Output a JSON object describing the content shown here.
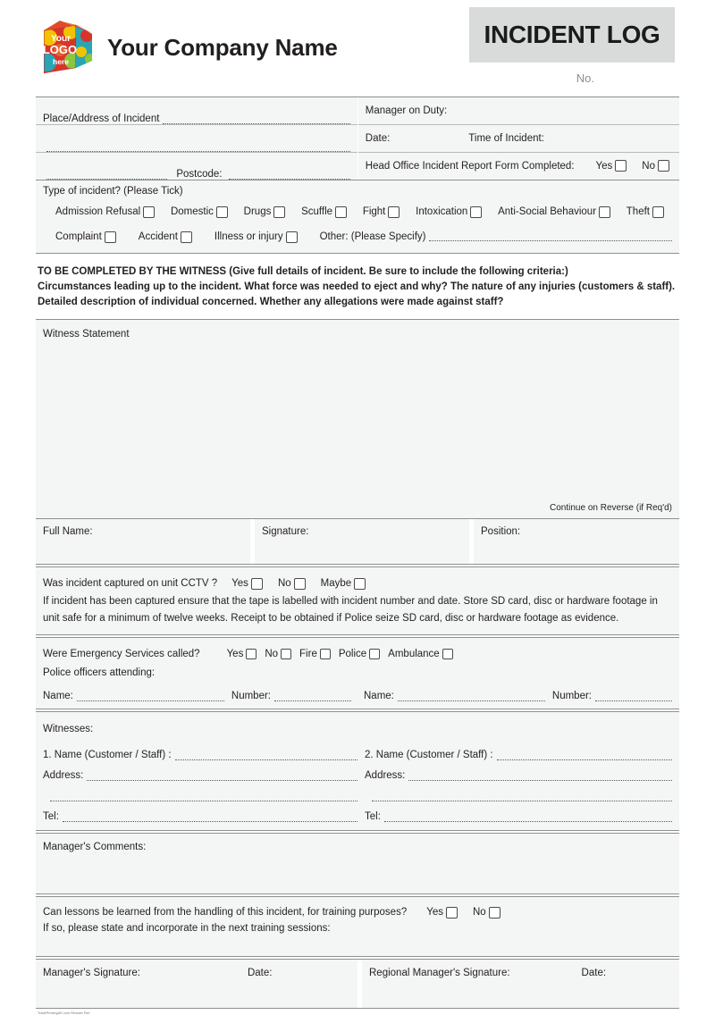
{
  "header": {
    "logo_alt": "Your LOGO here",
    "logo_line1": "Your",
    "logo_line2": "LOGO",
    "logo_line3": "here",
    "company_name": "Your Company Name",
    "form_title": "INCIDENT LOG",
    "number_label": "No."
  },
  "incident_place": {
    "place_label": "Place/Address of Incident",
    "postcode_label": "Postcode:",
    "manager_on_duty_label": "Manager on Duty:",
    "date_label": "Date:",
    "time_label": "Time of Incident:",
    "head_office_label": "Head Office Incident Report Form Completed:",
    "yes_label": "Yes",
    "no_label": "No"
  },
  "incident_type": {
    "title": "Type of incident? (Please Tick)",
    "row1": [
      "Admission Refusal",
      "Domestic",
      "Drugs",
      "Scuffle",
      "Fight",
      "Intoxication",
      "Anti-Social Behaviour",
      "Theft"
    ],
    "row2": [
      "Complaint",
      "Accident",
      "Illness or injury"
    ],
    "other_label": "Other: (Please Specify)"
  },
  "instructions": {
    "line1": "TO BE COMPLETED BY THE WITNESS (Give full details of incident. Be sure to include the following criteria:)",
    "line2": "Circumstances leading up to the incident. What force was needed to eject and why? The nature of any injuries (customers & staff).",
    "line3": "Detailed description of individual concerned. Whether any allegations were made against staff?"
  },
  "witness_statement": {
    "title": "Witness Statement",
    "continue_note": "Continue on Reverse (if Req'd)"
  },
  "witness_identity": {
    "full_name_label": "Full Name:",
    "signature_label": "Signature:",
    "position_label": "Position:"
  },
  "cctv": {
    "question": "Was incident captured on unit CCTV ?",
    "yes_label": "Yes",
    "no_label": "No",
    "maybe_label": "Maybe",
    "note": "If incident has been captured ensure that the tape is labelled with incident number and date. Store SD card, disc or hardware footage in unit safe for a minimum of twelve weeks. Receipt to be obtained if Police seize SD card, disc or hardware footage as evidence."
  },
  "emergency": {
    "question": "Were Emergency Services called?",
    "options": [
      "Yes",
      "No",
      "Fire",
      "Police",
      "Ambulance"
    ],
    "police_attending_label": "Police officers attending:",
    "name_label": "Name:",
    "number_label": "Number:"
  },
  "witnesses": {
    "title": "Witnesses:",
    "name1_label": "1. Name (Customer / Staff) :",
    "name2_label": "2. Name (Customer / Staff) :",
    "address_label": "Address:",
    "tel_label": "Tel:"
  },
  "manager_comments": {
    "label": "Manager's Comments:"
  },
  "lessons": {
    "question": "Can lessons be learned from the handling of this incident, for training purposes?",
    "yes_label": "Yes",
    "no_label": "No",
    "followup": "If so, please state and incorporate in the next training sessions:"
  },
  "signatures": {
    "manager_signature_label": "Manager's Signature:",
    "manager_date_label": "Date:",
    "regional_signature_label": "Regional Manager's Signature:",
    "regional_date_label": "Date:"
  },
  "footer": {
    "ref": "TradePrintingUK.com Reorder Ref:"
  },
  "colors": {
    "band": "#f4f5f5",
    "title_box": "#d9dbda",
    "rule": "#8c9093",
    "text": "#231f20",
    "muted": "#8b8d8e"
  }
}
